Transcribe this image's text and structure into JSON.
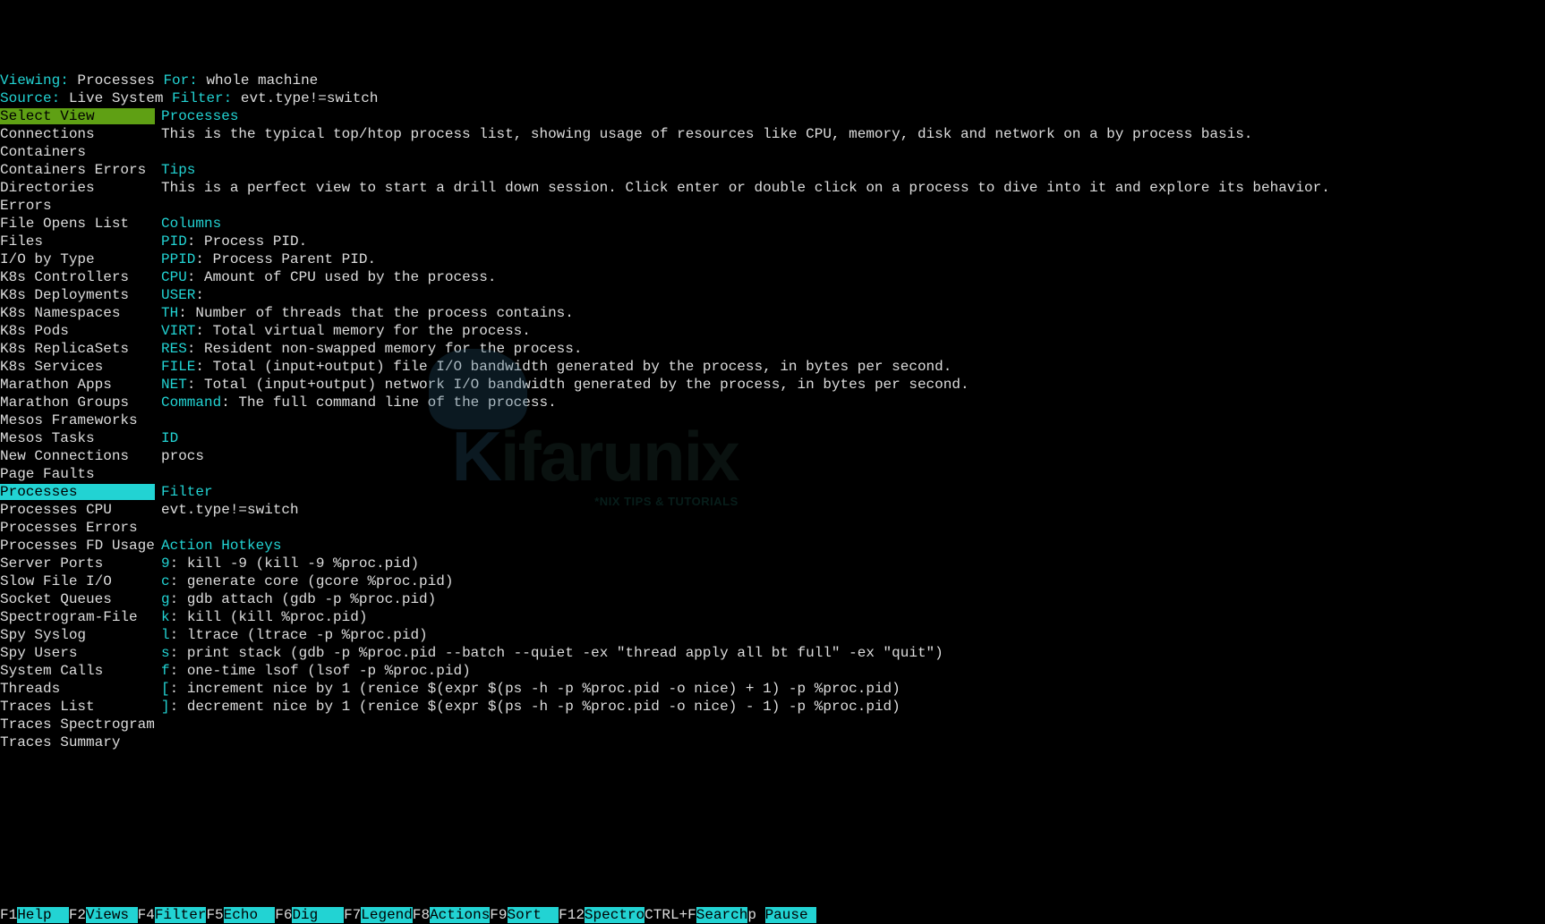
{
  "header": {
    "viewing_label": "Viewing:",
    "viewing_value": " Processes ",
    "for_label": "For:",
    "for_value": " whole machine",
    "source_label": "Source:",
    "source_value": " Live System ",
    "filter_label": "Filter:",
    "filter_value": " evt.type!=switch"
  },
  "sidebar": {
    "title": "Select View",
    "items": [
      "Connections",
      "Containers",
      "Containers Errors",
      "Directories",
      "Errors",
      "File Opens List",
      "Files",
      "I/O by Type",
      "K8s Controllers",
      "K8s Deployments",
      "K8s Namespaces",
      "K8s Pods",
      "K8s ReplicaSets",
      "K8s Services",
      "Marathon Apps",
      "Marathon Groups",
      "Mesos Frameworks",
      "Mesos Tasks",
      "New Connections",
      "Page Faults",
      "Processes",
      "Processes CPU",
      "Processes Errors",
      "Processes FD Usage",
      "Server Ports",
      "Slow File I/O",
      "Socket Queues",
      "Spectrogram-File",
      "Spy Syslog",
      "Spy Users",
      "System Calls",
      "Threads",
      "Traces List",
      "Traces Spectrogram",
      "Traces Summary"
    ],
    "selected_index": 20
  },
  "detail": {
    "title_label": "Processes",
    "description": "This is the typical top/htop process list, showing usage of resources like CPU, memory, disk and network on a by process basis.",
    "tips_label": "Tips",
    "tips_text": "This is a perfect view to start a drill down session. Click enter or double click on a process to dive into it and explore its behavior.",
    "columns_label": "Columns",
    "columns": [
      {
        "name": "PID",
        "desc": ": Process PID."
      },
      {
        "name": "PPID",
        "desc": ": Process Parent PID."
      },
      {
        "name": "CPU",
        "desc": ": Amount of CPU used by the process."
      },
      {
        "name": "USER",
        "desc": ":"
      },
      {
        "name": "TH",
        "desc": ": Number of threads that the process contains."
      },
      {
        "name": "VIRT",
        "desc": ": Total virtual memory for the process."
      },
      {
        "name": "RES",
        "desc": ": Resident non-swapped memory for the process."
      },
      {
        "name": "FILE",
        "desc": ": Total (input+output) file I/O bandwidth generated by the process, in bytes per second."
      },
      {
        "name": "NET",
        "desc": ": Total (input+output) network I/O bandwidth generated by the process, in bytes per second."
      },
      {
        "name": "Command",
        "desc": ": The full command line of the process."
      }
    ],
    "id_label": "ID",
    "id_value": "procs",
    "filter_label": "Filter",
    "filter_value": "evt.type!=switch",
    "hotkeys_label": "Action Hotkeys",
    "hotkeys": [
      {
        "key": "9",
        "desc": ": kill -9 (kill -9 %proc.pid)"
      },
      {
        "key": "c",
        "desc": ": generate core (gcore %proc.pid)"
      },
      {
        "key": "g",
        "desc": ": gdb attach (gdb -p %proc.pid)"
      },
      {
        "key": "k",
        "desc": ": kill (kill %proc.pid)"
      },
      {
        "key": "l",
        "desc": ": ltrace (ltrace -p %proc.pid)"
      },
      {
        "key": "s",
        "desc": ": print stack (gdb -p %proc.pid --batch --quiet -ex \"thread apply all bt full\" -ex \"quit\")"
      },
      {
        "key": "f",
        "desc": ": one-time lsof (lsof -p %proc.pid)"
      },
      {
        "key": "[",
        "desc": ": increment nice by 1 (renice $(expr $(ps -h -p %proc.pid -o nice) + 1) -p %proc.pid)"
      },
      {
        "key": "]",
        "desc": ": decrement nice by 1 (renice $(expr $(ps -h -p %proc.pid -o nice) - 1) -p %proc.pid)"
      }
    ]
  },
  "footer": {
    "items": [
      {
        "key": "F1",
        "label": "Help  "
      },
      {
        "key": "F2",
        "label": "Views "
      },
      {
        "key": "F4",
        "label": "Filter"
      },
      {
        "key": "F5",
        "label": "Echo  "
      },
      {
        "key": "F6",
        "label": "Dig   "
      },
      {
        "key": "F7",
        "label": "Legend"
      },
      {
        "key": "F8",
        "label": "Actions"
      },
      {
        "key": "F9",
        "label": "Sort  "
      },
      {
        "key": "F12",
        "label": "Spectro"
      },
      {
        "key": "CTRL+F",
        "label": "Search"
      },
      {
        "key": "p ",
        "label": "Pause "
      }
    ]
  },
  "watermark": {
    "brand1": "K",
    "brand2": "ifarunix",
    "sub": "*NIX TIPS & TUTORIALS"
  }
}
